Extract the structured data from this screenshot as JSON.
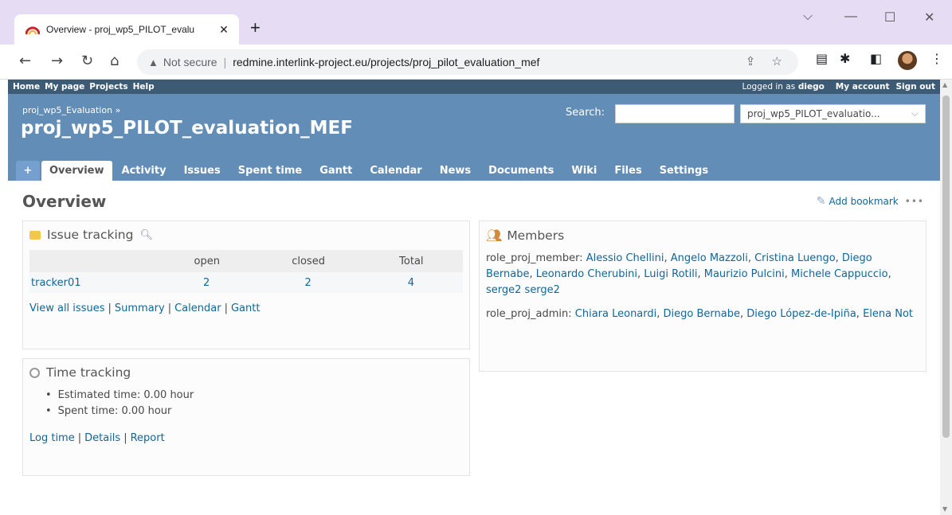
{
  "browser": {
    "tab_title": "Overview - proj_wp5_PILOT_evalu",
    "tab_close": "✕",
    "new_tab": "+",
    "warning": "▲",
    "not_secure": "Not secure",
    "url": "redmine.interlink-project.eu/projects/proj_pilot_evaluation_mef"
  },
  "top_menu": {
    "items": [
      "Home",
      "My page",
      "Projects",
      "Help"
    ],
    "logged_in_prefix": "Logged in as",
    "username": "diego",
    "my_account": "My account",
    "sign_out": "Sign out"
  },
  "header": {
    "parent": "proj_wp5_Evaluation »",
    "title": "proj_wp5_PILOT_evaluation_MEF",
    "search_label": "Search:",
    "search_value": "",
    "project_select": "proj_wp5_PILOT_evaluatio..."
  },
  "main_menu": {
    "new": "+",
    "items": [
      "Overview",
      "Activity",
      "Issues",
      "Spent time",
      "Gantt",
      "Calendar",
      "News",
      "Documents",
      "Wiki",
      "Files",
      "Settings"
    ]
  },
  "content": {
    "heading": "Overview",
    "add_bookmark": "Add bookmark",
    "more": "•••"
  },
  "issue_tracking": {
    "title": "Issue tracking",
    "columns": [
      "",
      "open",
      "closed",
      "Total"
    ],
    "rows": [
      {
        "tracker": "tracker01",
        "open": "2",
        "closed": "2",
        "total": "4"
      }
    ],
    "links": [
      "View all issues",
      "Summary",
      "Calendar",
      "Gantt"
    ]
  },
  "time_tracking": {
    "title": "Time tracking",
    "estimated": "Estimated time: 0.00 hour",
    "spent": "Spent time: 0.00 hour",
    "links": [
      "Log time",
      "Details",
      "Report"
    ]
  },
  "members": {
    "title": "Members",
    "groups": [
      {
        "role": "role_proj_member:",
        "names": [
          "Alessio Chellini",
          "Angelo Mazzoli",
          "Cristina Luengo",
          "Diego Bernabe",
          "Leonardo Cherubini",
          "Luigi Rotili",
          "Maurizio Pulcini",
          "Michele Cappuccio",
          "serge2 serge2"
        ]
      },
      {
        "role": "role_proj_admin:",
        "names": [
          "Chiara Leonardi",
          "Diego Bernabe",
          "Diego López-de-Ipiña",
          "Elena Not"
        ]
      }
    ]
  }
}
